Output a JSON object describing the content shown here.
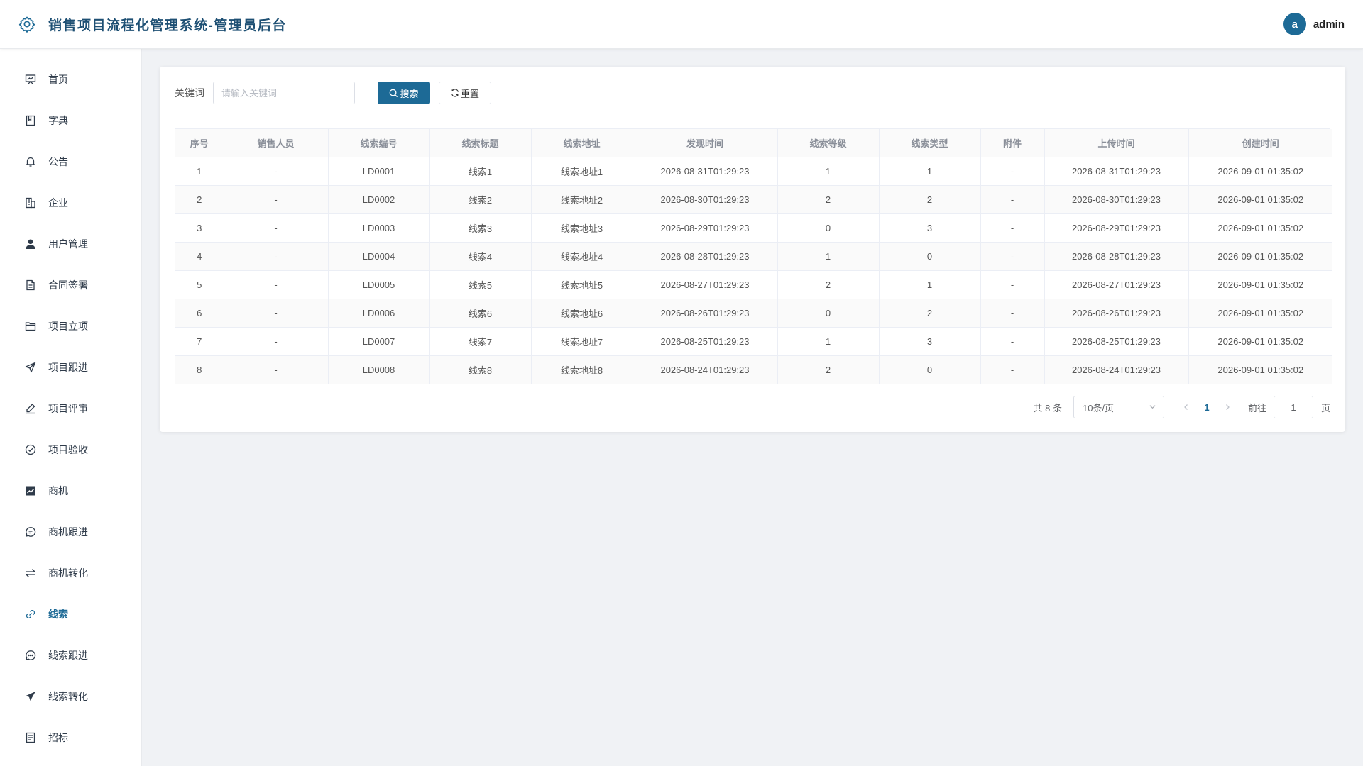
{
  "header": {
    "title": "销售项目流程化管理系统-管理员后台",
    "avatar_initial": "a",
    "username": "admin"
  },
  "sidebar": {
    "items": [
      {
        "label": "首页",
        "icon": "dashboard-icon"
      },
      {
        "label": "字典",
        "icon": "book-icon"
      },
      {
        "label": "公告",
        "icon": "bell-icon"
      },
      {
        "label": "企业",
        "icon": "building-icon"
      },
      {
        "label": "用户管理",
        "icon": "user-icon"
      },
      {
        "label": "合同签署",
        "icon": "document-icon"
      },
      {
        "label": "项目立项",
        "icon": "folder-icon"
      },
      {
        "label": "项目跟进",
        "icon": "send-icon"
      },
      {
        "label": "项目评审",
        "icon": "edit-pen-icon"
      },
      {
        "label": "项目验收",
        "icon": "check-circle-icon"
      },
      {
        "label": "商机",
        "icon": "trend-chart-icon"
      },
      {
        "label": "商机跟进",
        "icon": "chat-icon"
      },
      {
        "label": "商机转化",
        "icon": "swap-icon"
      },
      {
        "label": "线索",
        "icon": "link-icon"
      },
      {
        "label": "线索跟进",
        "icon": "chat-dots-icon"
      },
      {
        "label": "线索转化",
        "icon": "paper-plane-icon"
      },
      {
        "label": "招标",
        "icon": "tender-doc-icon"
      }
    ],
    "active_index": 13,
    "active_color": "#1d6a96"
  },
  "search": {
    "label": "关键词",
    "placeholder": "请输入关键词",
    "value": "",
    "search_button": "搜索",
    "reset_button": "重置"
  },
  "table": {
    "columns": [
      "序号",
      "销售人员",
      "线索编号",
      "线索标题",
      "线索地址",
      "发现时间",
      "线索等级",
      "线索类型",
      "附件",
      "上传时间",
      "创建时间"
    ],
    "rows": [
      [
        "1",
        "-",
        "LD0001",
        "线索1",
        "线索地址1",
        "2026-08-31T01:29:23",
        "1",
        "1",
        "-",
        "2026-08-31T01:29:23",
        "2026-09-01 01:35:02"
      ],
      [
        "2",
        "-",
        "LD0002",
        "线索2",
        "线索地址2",
        "2026-08-30T01:29:23",
        "2",
        "2",
        "-",
        "2026-08-30T01:29:23",
        "2026-09-01 01:35:02"
      ],
      [
        "3",
        "-",
        "LD0003",
        "线索3",
        "线索地址3",
        "2026-08-29T01:29:23",
        "0",
        "3",
        "-",
        "2026-08-29T01:29:23",
        "2026-09-01 01:35:02"
      ],
      [
        "4",
        "-",
        "LD0004",
        "线索4",
        "线索地址4",
        "2026-08-28T01:29:23",
        "1",
        "0",
        "-",
        "2026-08-28T01:29:23",
        "2026-09-01 01:35:02"
      ],
      [
        "5",
        "-",
        "LD0005",
        "线索5",
        "线索地址5",
        "2026-08-27T01:29:23",
        "2",
        "1",
        "-",
        "2026-08-27T01:29:23",
        "2026-09-01 01:35:02"
      ],
      [
        "6",
        "-",
        "LD0006",
        "线索6",
        "线索地址6",
        "2026-08-26T01:29:23",
        "0",
        "2",
        "-",
        "2026-08-26T01:29:23",
        "2026-09-01 01:35:02"
      ],
      [
        "7",
        "-",
        "LD0007",
        "线索7",
        "线索地址7",
        "2026-08-25T01:29:23",
        "1",
        "3",
        "-",
        "2026-08-25T01:29:23",
        "2026-09-01 01:35:02"
      ],
      [
        "8",
        "-",
        "LD0008",
        "线索8",
        "线索地址8",
        "2026-08-24T01:29:23",
        "2",
        "0",
        "-",
        "2026-08-24T01:29:23",
        "2026-09-01 01:35:02"
      ]
    ]
  },
  "pagination": {
    "total_text": "共 8 条",
    "page_size": "10条/页",
    "current_page": "1",
    "goto_label": "前往",
    "goto_value": "1",
    "goto_suffix": "页"
  }
}
